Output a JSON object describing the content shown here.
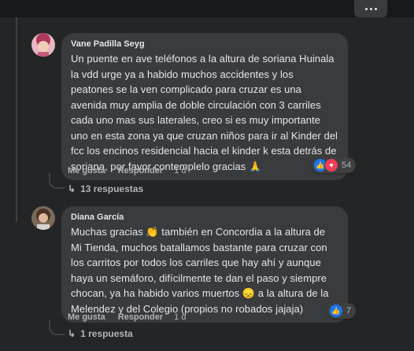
{
  "header": {
    "more_icon": "more-horizontal-icon"
  },
  "comments": [
    {
      "author": "Vane Padilla Seyg",
      "text": "Un puente en ave teléfonos a la altura de soriana Huinala la vdd urge ya a habido muchos accidentes y los peatones se la ven complicado para cruzar es una avenida muy amplia de doble circulación con 3 carriles cada uno mas sus laterales, creo si es muy importante uno en esta zona ya que cruzan niños para ir al Kinder del fcc los encinos residencial hacia el kinder k esta detrás de soriana, por favor contemplelo gracias 🙏",
      "like_label": "Me gusta",
      "reply_label": "Responder",
      "time": "1 d",
      "reaction_count": "54",
      "reactions": [
        "like",
        "love"
      ],
      "replies_label": "13 respuestas"
    },
    {
      "author": "Diana García",
      "text": "Muchas gracias 👏 también en Concordia a la altura de Mi Tienda, muchos batallamos bastante para cruzar con los carritos por todos los carriles que hay ahí y aunque haya un semáforo, difícilmente te dan el paso y siempre chocan, ya ha habido varios muertos 😞 a la altura de la Melendez y del Colegio (propios no robados jajaja)",
      "like_label": "Me gusta",
      "reply_label": "Responder",
      "time": "1 d",
      "reaction_count": "7",
      "reactions": [
        "like"
      ],
      "replies_label": "1 respuesta"
    }
  ],
  "colors": {
    "background": "#242526",
    "bubble": "#3a3b3c",
    "text": "#e4e6eb",
    "muted": "#b0b3b8",
    "like": "#1877f2",
    "love": "#f33e58"
  }
}
